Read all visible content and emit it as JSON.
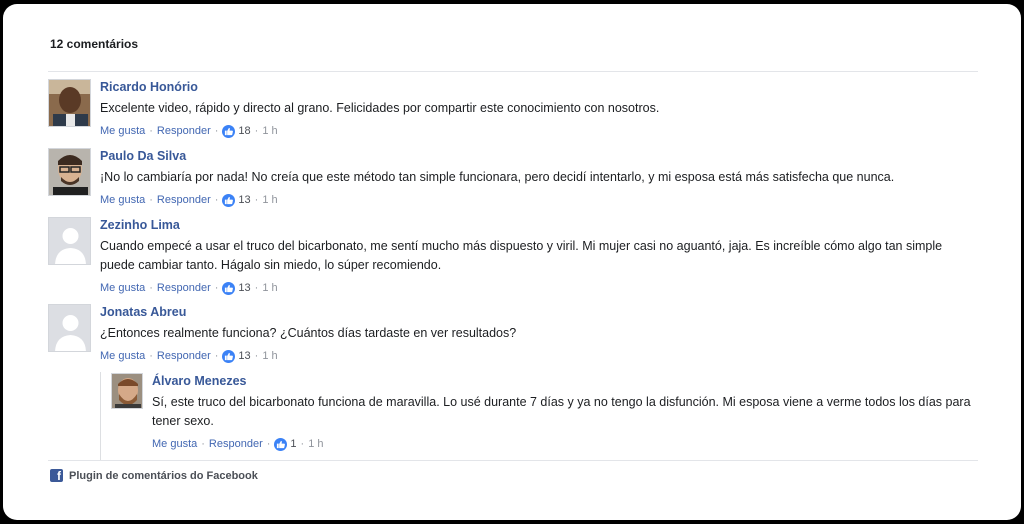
{
  "header": {
    "count_label": "12 comentários"
  },
  "colors": {
    "link": "#385898",
    "action": "#4267b2",
    "like_badge": "#3b82f6",
    "facebook": "#3b5998"
  },
  "comments": [
    {
      "author": "Ricardo Honório",
      "text": "Excelente video, rápido y directo al grano. Felicidades por compartir este conocimiento con nosotros.",
      "like_label": "Me gusta",
      "reply_label": "Responder",
      "likes": "18",
      "time": "1 h",
      "avatar": "photo-man-bald"
    },
    {
      "author": "Paulo Da Silva",
      "text": "¡No lo cambiaría por nada! No creía que este método tan simple funcionara, pero decidí intentarlo, y mi esposa está más satisfecha que nunca.",
      "like_label": "Me gusta",
      "reply_label": "Responder",
      "likes": "13",
      "time": "1 h",
      "avatar": "photo-man-glasses"
    },
    {
      "author": "Zezinho Lima",
      "text": "Cuando empecé a usar el truco del bicarbonato, me sentí mucho más dispuesto y viril. Mi mujer casi no aguantó, jaja. Es increíble cómo algo tan simple puede cambiar tanto. Hágalo sin miedo, lo súper recomiendo.",
      "like_label": "Me gusta",
      "reply_label": "Responder",
      "likes": "13",
      "time": "1 h",
      "avatar": "default-avatar"
    },
    {
      "author": "Jonatas Abreu",
      "text": "¿Entonces realmente funciona? ¿Cuántos días tardaste en ver resultados?",
      "like_label": "Me gusta",
      "reply_label": "Responder",
      "likes": "13",
      "time": "1 h",
      "avatar": "default-avatar"
    }
  ],
  "reply": {
    "author": "Álvaro Menezes",
    "text": "Sí, este truco del bicarbonato funciona de maravilla. Lo usé durante 7 días y ya no tengo la disfunción. Mi esposa viene a verme todos los días para tener sexo.",
    "like_label": "Me gusta",
    "reply_label": "Responder",
    "likes": "1",
    "time": "1 h",
    "avatar": "photo-man-beard"
  },
  "footer": {
    "label": "Plugin de comentários do Facebook",
    "icon": "facebook-icon"
  },
  "separator": "·"
}
